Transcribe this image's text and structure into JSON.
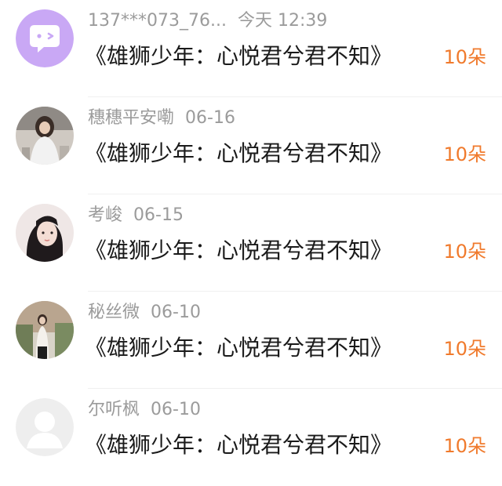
{
  "gift_list": [
    {
      "username": "137***073_76...",
      "time": "今天 12:39",
      "title": "《雄狮少年：心悦君兮君不知》",
      "count": "10朵",
      "avatar": "chat-bubble-icon"
    },
    {
      "username": "穗穗平安嘞",
      "time": "06-16",
      "title": "《雄狮少年：心悦君兮君不知》",
      "count": "10朵",
      "avatar": "photo-avatar"
    },
    {
      "username": "考峻",
      "time": "06-15",
      "title": "《雄狮少年：心悦君兮君不知》",
      "count": "10朵",
      "avatar": "photo-avatar"
    },
    {
      "username": "秘丝微",
      "time": "06-10",
      "title": "《雄狮少年：心悦君兮君不知》",
      "count": "10朵",
      "avatar": "photo-avatar"
    },
    {
      "username": "尔听枫",
      "time": "06-10",
      "title": "《雄狮少年：心悦君兮君不知》",
      "count": "10朵",
      "avatar": "default-user-icon"
    }
  ],
  "colors": {
    "accent_count": "#f07a2c",
    "meta_text": "#9b9b9b",
    "title_text": "#1a1a1a",
    "avatar_purple": "#c9a8f5"
  }
}
